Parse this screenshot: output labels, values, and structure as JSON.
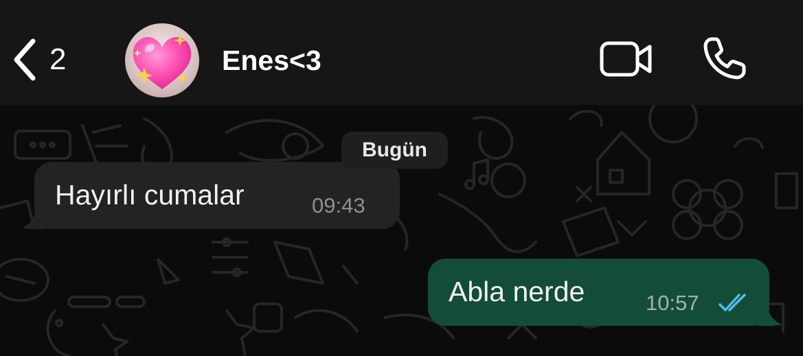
{
  "header": {
    "back_icon": "chevron-left-icon",
    "unread_count": "2",
    "contact_name": "Enes<3",
    "avatar_icon": "sparkling-heart-icon",
    "video_call_icon": "video-camera-icon",
    "voice_call_icon": "phone-icon"
  },
  "chat": {
    "date_badge": "Bugün",
    "messages": [
      {
        "direction": "incoming",
        "text": "Hayırlı cumalar",
        "time": "09:43"
      },
      {
        "direction": "outgoing",
        "text": "Abla nerde",
        "time": "10:57",
        "status_icon": "double-check-read-icon"
      }
    ]
  },
  "colors": {
    "header_bg": "#161616",
    "chat_bg": "#0b0b0b",
    "incoming_bubble": "#222324",
    "outgoing_bubble": "#144d37",
    "read_ticks": "#53bdeb",
    "text": "#f2f2f2"
  }
}
